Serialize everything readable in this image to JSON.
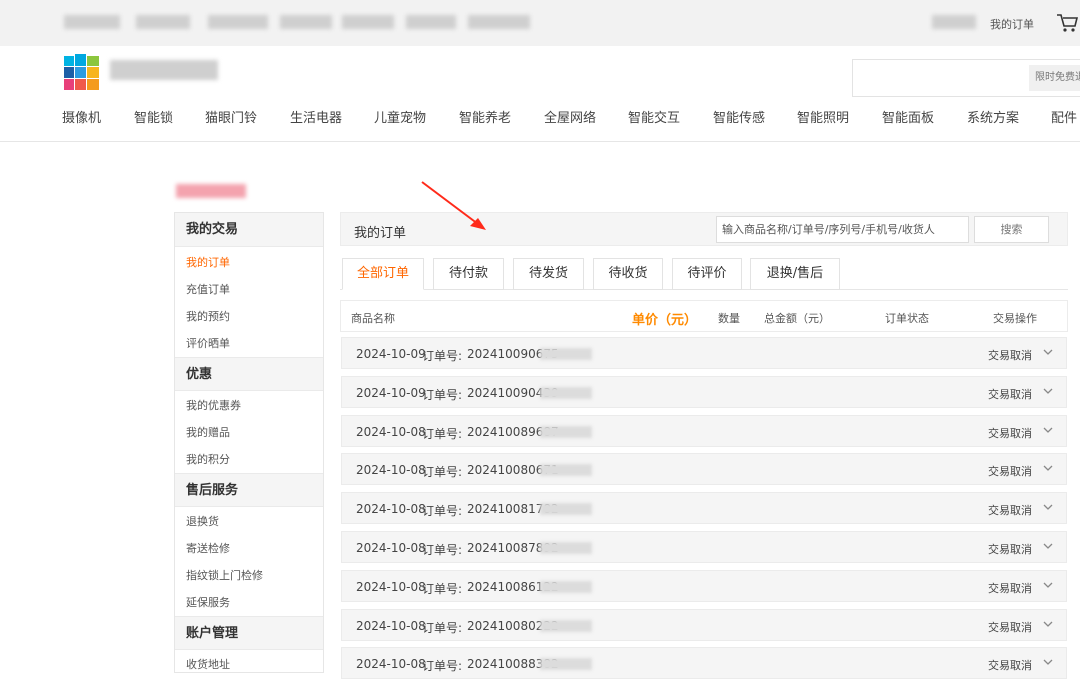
{
  "topbar": {
    "my_orders": "我的订单"
  },
  "header": {
    "search_hint": "限时免费退"
  },
  "category_nav": [
    "摄像机",
    "智能锁",
    "猫眼门铃",
    "生活电器",
    "儿童宠物",
    "智能养老",
    "全屋网络",
    "智能交互",
    "智能传感",
    "智能照明",
    "智能面板",
    "系统方案",
    "配件"
  ],
  "sidebar": {
    "sections": [
      {
        "title": "我的交易",
        "items": [
          "我的订单",
          "充值订单",
          "我的预约",
          "评价晒单"
        ]
      },
      {
        "title": "优惠",
        "items": [
          "我的优惠券",
          "我的赠品",
          "我的积分"
        ]
      },
      {
        "title": "售后服务",
        "items": [
          "退换货",
          "寄送检修",
          "指纹锁上门检修",
          "延保服务"
        ]
      },
      {
        "title": "账户管理",
        "items": [
          "收货地址"
        ]
      }
    ],
    "active_item": "我的订单"
  },
  "main": {
    "title": "我的订单",
    "search_placeholder": "输入商品名称/订单号/序列号/手机号/收货人",
    "search_button": "搜索",
    "tabs": [
      "全部订单",
      "待付款",
      "待发货",
      "待收货",
      "待评价",
      "退换/售后"
    ],
    "active_tab": "全部订单",
    "columns": {
      "name": "商品名称",
      "price": "单价（元）",
      "qty": "数量",
      "total": "总金额（元）",
      "status": "订单状态",
      "action": "交易操作"
    },
    "order_label": "订单号:",
    "orders": [
      {
        "date": "2024-10-09",
        "order_no": "202410090675",
        "status": "交易取消"
      },
      {
        "date": "2024-10-09",
        "order_no": "202410090439",
        "status": "交易取消"
      },
      {
        "date": "2024-10-08",
        "order_no": "202410089687",
        "status": "交易取消"
      },
      {
        "date": "2024-10-08",
        "order_no": "202410080671",
        "status": "交易取消"
      },
      {
        "date": "2024-10-08",
        "order_no": "202410081782",
        "status": "交易取消"
      },
      {
        "date": "2024-10-08",
        "order_no": "202410087892",
        "status": "交易取消"
      },
      {
        "date": "2024-10-08",
        "order_no": "202410086122",
        "status": "交易取消"
      },
      {
        "date": "2024-10-08",
        "order_no": "202410080222",
        "status": "交易取消"
      },
      {
        "date": "2024-10-08",
        "order_no": "202410088382",
        "status": "交易取消"
      }
    ]
  },
  "colors": {
    "accent": "#ff6600",
    "price_header": "#ff8a00",
    "annotation_arrow": "#ff2a1a"
  }
}
